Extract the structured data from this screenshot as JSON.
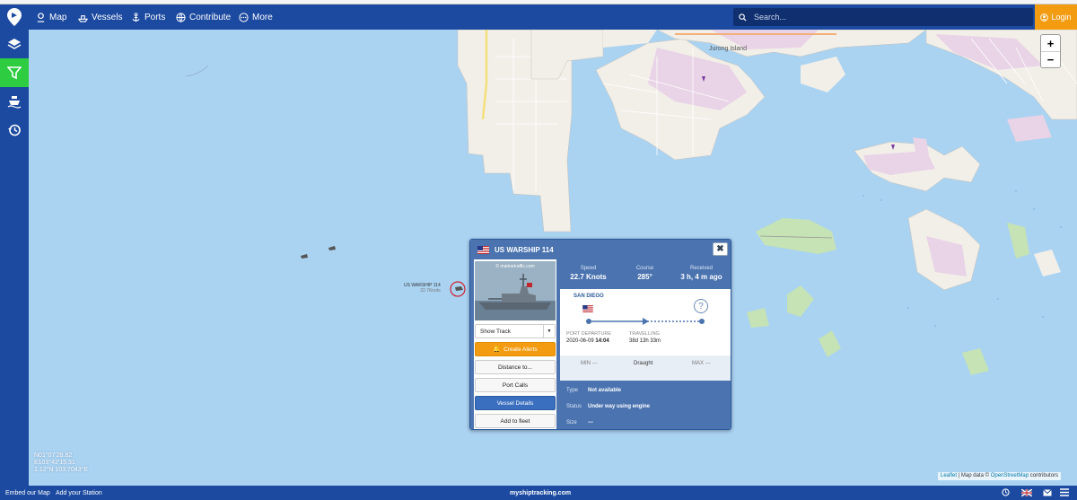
{
  "nav": {
    "items": [
      {
        "label": "Map",
        "icon": "map-icon"
      },
      {
        "label": "Vessels",
        "icon": "ship-icon"
      },
      {
        "label": "Ports",
        "icon": "anchor-icon"
      },
      {
        "label": "Contribute",
        "icon": "globe-icon"
      },
      {
        "label": "More",
        "icon": "more-icon"
      }
    ],
    "search_placeholder": "Search...",
    "login_label": "Login"
  },
  "sidebar": [
    "layers-icon",
    "filter-icon",
    "fleet-icon",
    "history-icon"
  ],
  "zoom": {
    "in": "+",
    "out": "−"
  },
  "map": {
    "place_label": "Jurong Island",
    "vessel_label_name": "US WARSHIP 114",
    "vessel_label_speed": "22.7Knots",
    "coords_line1": "N01°07'28.82",
    "coords_line2": "E103°42'15.31",
    "coords_line3": "1.12°N 103.7043°E",
    "attribution_leaflet": "Leaflet",
    "attribution_sep": " | Map data © ",
    "attribution_osm": "OpenStreetMap",
    "attribution_tail": " contributors"
  },
  "popup": {
    "title": "US WARSHIP 114",
    "close": "✖",
    "photo_credit": "© marinetraffic.com",
    "buttons": {
      "show_track": "Show Track",
      "create_alerts": "Create Alerts",
      "distance_to": "Distance to...",
      "port_calls": "Port Calls",
      "vessel_details": "Vessel Details",
      "add_to_fleet": "Add to fleet"
    },
    "stats": {
      "speed_label": "Speed",
      "speed_value": "22.7 Knots",
      "course_label": "Course",
      "course_value": "285°",
      "received_label": "Received",
      "received_value": "3 h, 4 m ago"
    },
    "route": {
      "destination": "SAN DIEGO",
      "unknown_marker": "?",
      "port_departure_label": "PORT DEPARTURE",
      "port_departure_date": "2020-06-09",
      "port_departure_time": "14:04",
      "travelling_label": "TRAVELLING",
      "travelling_value": "38d 13h 33m"
    },
    "draught": {
      "min": "MIN ---",
      "label": "Draught",
      "max": "MAX ---"
    },
    "info": {
      "type_label": "Type",
      "type_value": "Not available",
      "status_label": "Status",
      "status_value": "Under way using engine",
      "size_label": "Size",
      "size_value": "---"
    }
  },
  "footer": {
    "embed": "Embed our Map",
    "add_station": "Add your Station",
    "site": "myshiptracking.com"
  },
  "colors": {
    "nav": "#1c4aa0",
    "accent": "#f39c12",
    "active": "#2ecc40",
    "sea": "#aad3f2",
    "popup": "#4a73b0"
  }
}
